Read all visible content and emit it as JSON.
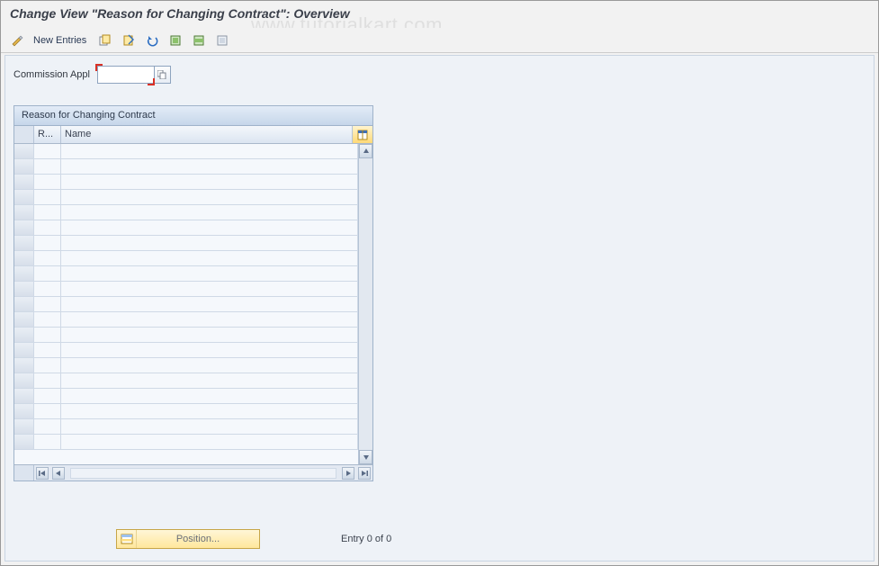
{
  "header": {
    "title": "Change View \"Reason for Changing Contract\": Overview"
  },
  "watermark": "www.tutorialkart.com",
  "toolbar": {
    "new_entries_label": "New Entries",
    "icons": {
      "toggle": "pencil-glasses-icon",
      "copy": "copy-icon",
      "delete": "delete-icon",
      "undo": "undo-icon",
      "select_all": "select-all-icon",
      "select_block": "select-block-icon",
      "deselect_all": "deselect-all-icon"
    }
  },
  "form": {
    "commission_appl_label": "Commission Appl",
    "commission_appl_value": ""
  },
  "table": {
    "group_title": "Reason for Changing Contract",
    "columns": {
      "col1": "R...",
      "col2": "Name"
    },
    "row_count": 20,
    "config_icon": "table-settings-icon"
  },
  "footer": {
    "position_button_label": "Position...",
    "entry_text": "Entry 0 of 0"
  }
}
